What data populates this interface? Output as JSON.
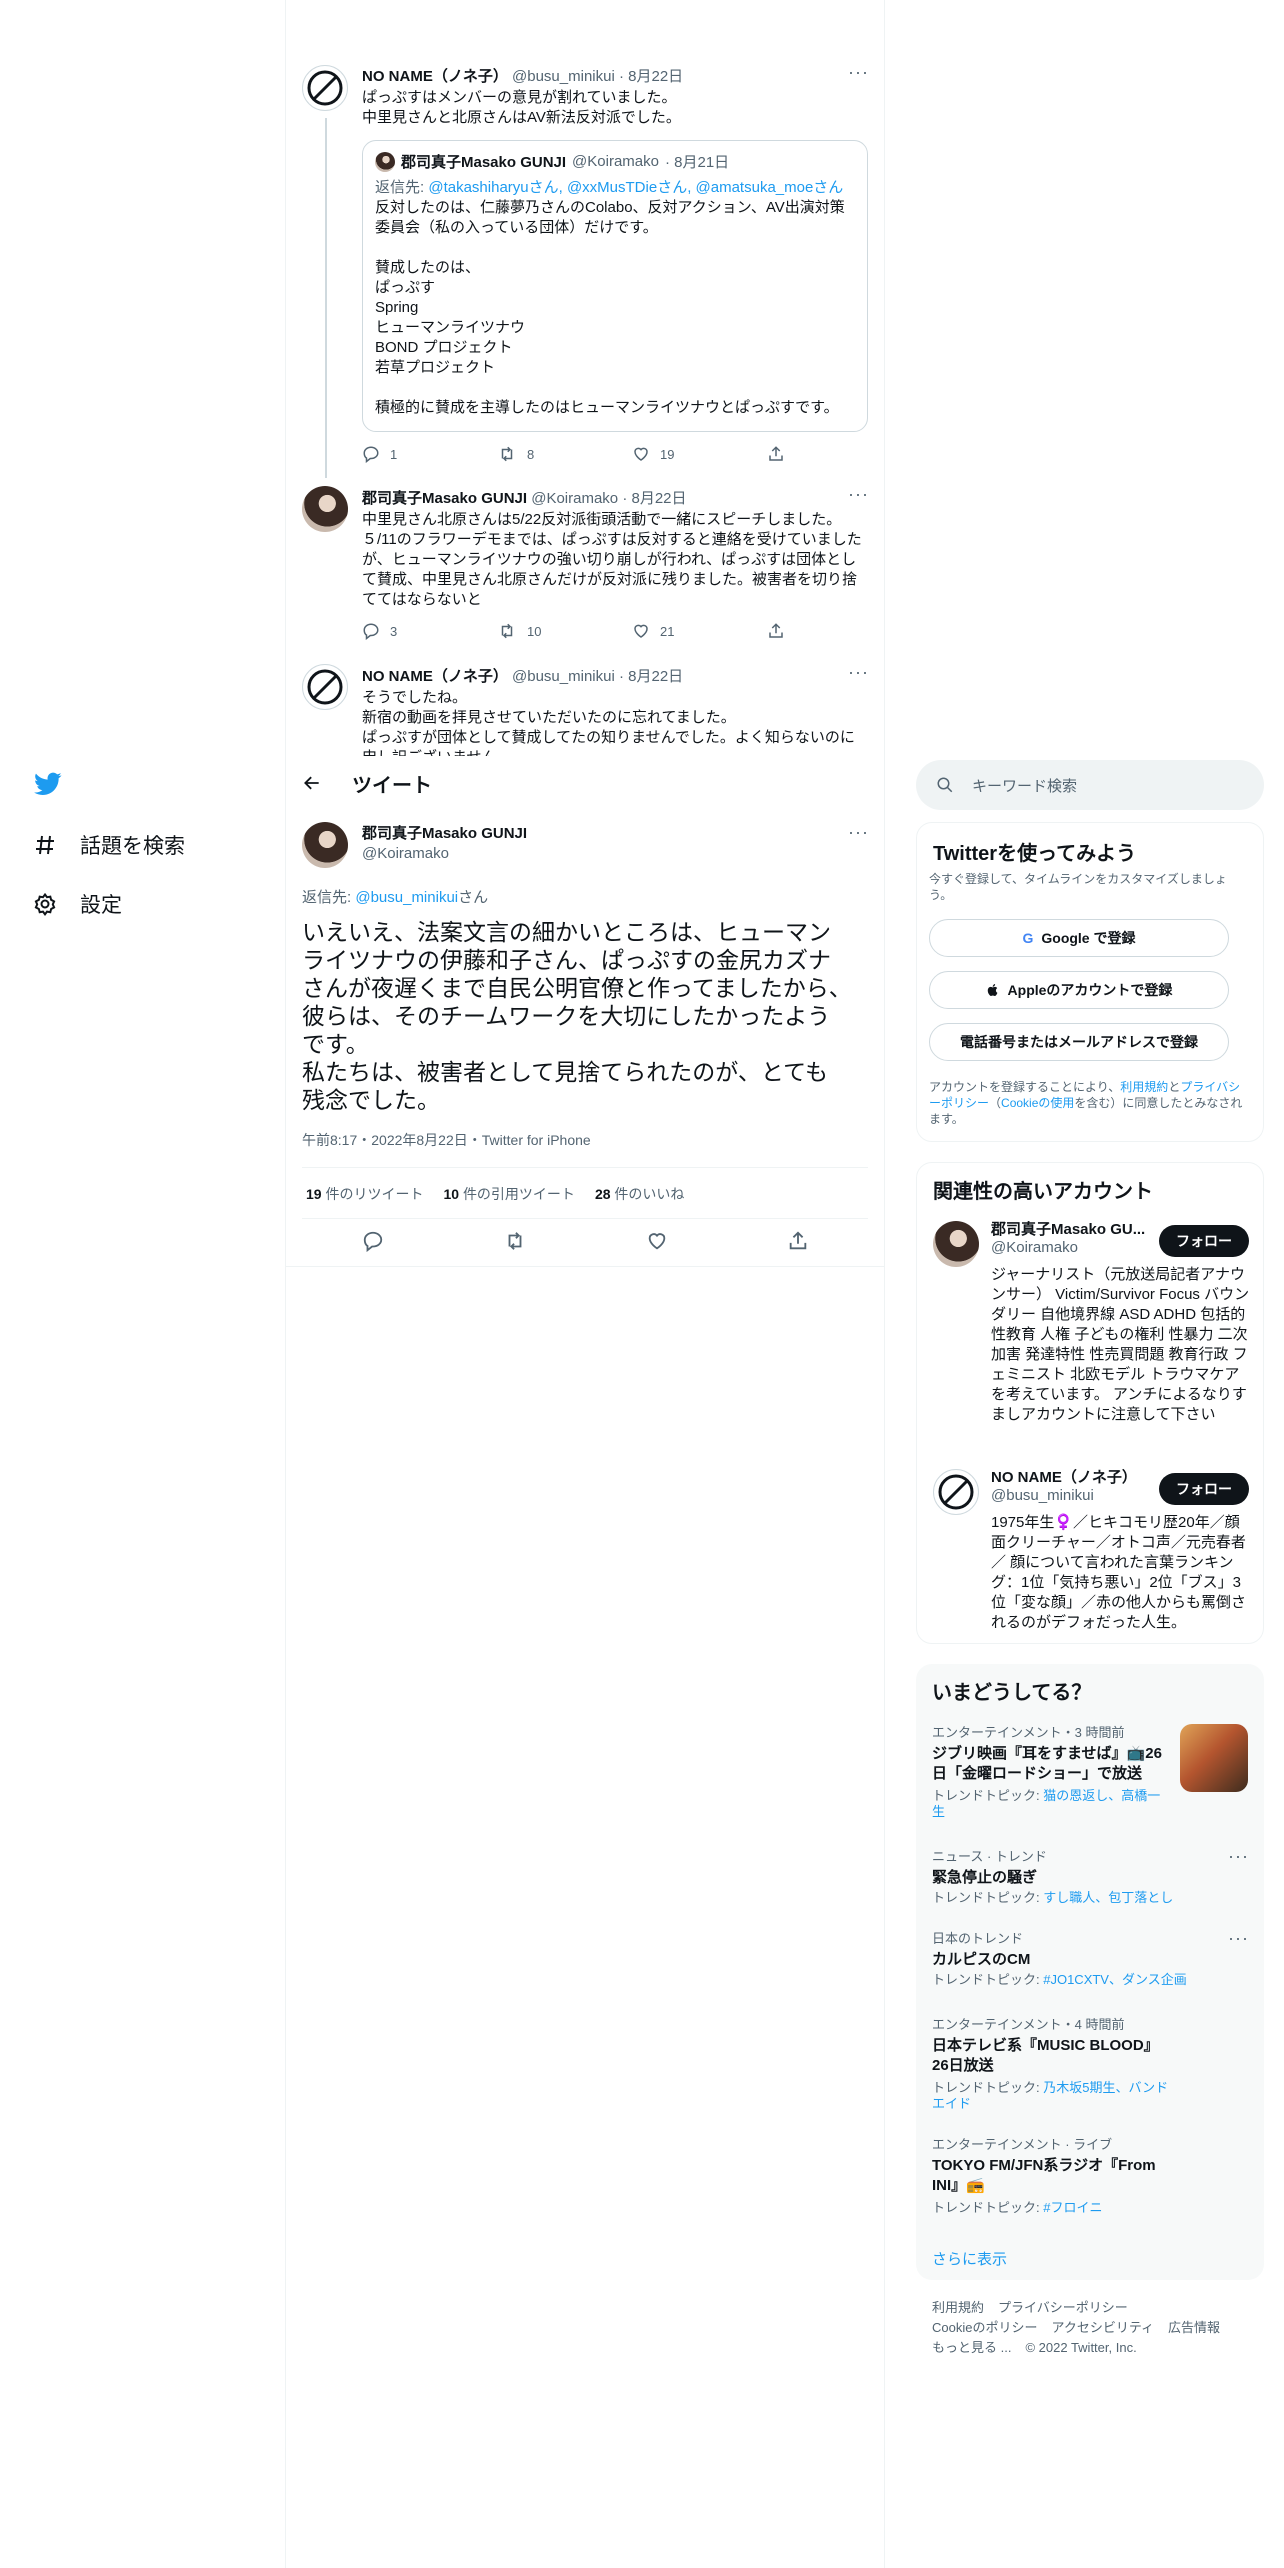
{
  "nav": {
    "explore_label": "話題を検索",
    "settings_label": "設定"
  },
  "feed": {
    "t1": {
      "name": "NO NAME（ノネ子）",
      "handle": "@busu_minikui",
      "date": "· 8月22日",
      "lines": [
        "ぱっぷすはメンバーの意見が割れていました。",
        "中里見さんと北原さんはAV新法反対派でした。"
      ],
      "quote": {
        "name": "郡司真子Masako GUNJI",
        "handle": "@Koiramako",
        "date": "· 8月21日",
        "reply_prefix": "返信先: ",
        "reply_to": "@takashiharyuさん, @xxMusTDieさん, @amatsuka_moeさん",
        "lines": [
          "反対したのは、仁藤夢乃さんのColabo、反対アクション、AV出演対策",
          "委員会（私の入っている団体）だけです。",
          "",
          "賛成したのは、",
          "ぱっぷす",
          "Spring",
          "ヒューマンライツナウ",
          "BOND プロジェクト",
          "若草プロジェクト",
          "",
          "積極的に賛成を主導したのはヒューマンライツナウとぱっぷすです。"
        ]
      },
      "replies": "1",
      "retweets": "8",
      "likes": "19"
    },
    "t2": {
      "name": "郡司真子Masako GUNJI",
      "handle": "@Koiramako",
      "date": "· 8月22日",
      "lines": [
        "中里見さん北原さんは5/22反対派街頭活動で一緒にスピーチしました。",
        "５/11のフラワーデモまでは、ぱっぷすは反対すると連絡を受けていましたが、ヒューマンライツナウの強い切り崩しが行われ、ぱっぷすは団体として賛成、中里見さん北原さんだけが反対派に残りました。被害者を切り捨ててはならないと"
      ],
      "replies": "3",
      "retweets": "10",
      "likes": "21"
    },
    "t3": {
      "name": "NO NAME（ノネ子）",
      "handle": "@busu_minikui",
      "date": "· 8月22日",
      "lines": [
        "そうでしたね。",
        "新宿の動画を拝見させていただいたのに忘れてました。",
        "ぱっぷすが団体として賛成してたの知りませんでした。よく知らないのに",
        "申し訳ございません。"
      ]
    }
  },
  "header": {
    "title": "ツイート"
  },
  "main_tweet": {
    "name": "郡司真子Masako GUNJI",
    "handle": "@Koiramako",
    "reply_prefix": "返信先: ",
    "reply_to": "@busu_minikui",
    "reply_suffix": "さん",
    "text_lines": [
      "いえいえ、法案文言の細かいところは、ヒューマン",
      "ライツナウの伊藤和子さん、ぱっぷすの金尻カズナ",
      "さんが夜遅くまで自民公明官僚と作ってましたから、",
      "彼らは、そのチームワークを大切にしたかったよう",
      "です。",
      "私たちは、被害者として見捨てられたのが、とても",
      "残念でした。"
    ],
    "meta": "午前8:17・2022年8月22日・Twitter for iPhone",
    "retweet_count": "19",
    "retweet_label": "件のリツイート",
    "quote_count": "10",
    "quote_label": "件の引用ツイート",
    "like_count": "28",
    "like_label": "件のいいね"
  },
  "search": {
    "placeholder": "キーワード検索"
  },
  "signup": {
    "title": "Twitterを使ってみよう",
    "subtitle": "今すぐ登録して、タイムラインをカスタマイズしましょう。",
    "google": "Google で登録",
    "apple": "Appleのアカウントで登録",
    "phone": "電話番号またはメールアドレスで登録",
    "legal_1": "アカウントを登録することにより、",
    "legal_tos": "利用規約",
    "legal_2": "と",
    "legal_privacy": "プライバシーポリシー",
    "legal_3": "（",
    "legal_cookie": "Cookieの使用",
    "legal_4": "を含む）に同意したとみなされます。"
  },
  "related": {
    "title": "関連性の高いアカウント",
    "follow_label": "フォロー",
    "accounts": [
      {
        "name": "郡司真子Masako GU...",
        "handle": "@Koiramako",
        "bio": "ジャーナリスト（元放送局記者アナウンサー） Victim/Survivor Focus バウンダリー 自他境界線 ASD ADHD 包括的性教育 人権 子どもの権利 性暴力 二次加害 発達特性 性売買問題 教育行政 フェミニスト 北欧モデル トラウマケアを考えています。 アンチによるなりすましアカウントに注意して下さい"
      },
      {
        "name": "NO NAME（ノネ子）",
        "handle": "@busu_minikui",
        "bio": "1975年生♀️／ヒキコモリ歴20年／顔面クリーチャー／オトコ声／元売春者／ 顔について言われた言葉ランキング：1位「気持ち悪い」2位「ブス」3位「変な顔」／赤の他人からも罵倒されるのがデフォだった人生。"
      }
    ]
  },
  "trends": {
    "title": "いまどうしてる？",
    "show_more": "さらに表示",
    "topic_prefix": "トレンドトピック: ",
    "items": [
      {
        "category": "エンターテインメント・3 時間前",
        "title": "ジブリ映画『耳をすませば』📺26日「金曜ロードショー」で放送",
        "topics": "猫の恩返し、高橋一生"
      },
      {
        "category": "ニュース · トレンド",
        "title": "緊急停止の騒ぎ",
        "topics": "すし職人、包丁落とし"
      },
      {
        "category": "日本のトレンド",
        "title": "カルピスのCM",
        "topics": "#JO1CXTV、ダンス企画"
      },
      {
        "category": "エンターテインメント・4 時間前",
        "title": "日本テレビ系『MUSIC BLOOD』26日放送",
        "topics": "乃木坂5期生、バンドエイド"
      },
      {
        "category": "エンターテインメント · ライブ",
        "title": "TOKYO FM/JFN系ラジオ『From INI』📻",
        "topics": "#フロイニ"
      }
    ]
  },
  "footer": {
    "links_row1": [
      "利用規約",
      "プライバシーポリシー"
    ],
    "links_row2": [
      "Cookieのポリシー",
      "アクセシビリティ",
      "広告情報"
    ],
    "more": "もっと見る ...",
    "copyright": "© 2022 Twitter, Inc."
  },
  "colors": {
    "accent": "#1d9bf0",
    "text": "#0f1419",
    "muted": "#536471",
    "border": "#eff3f4"
  }
}
